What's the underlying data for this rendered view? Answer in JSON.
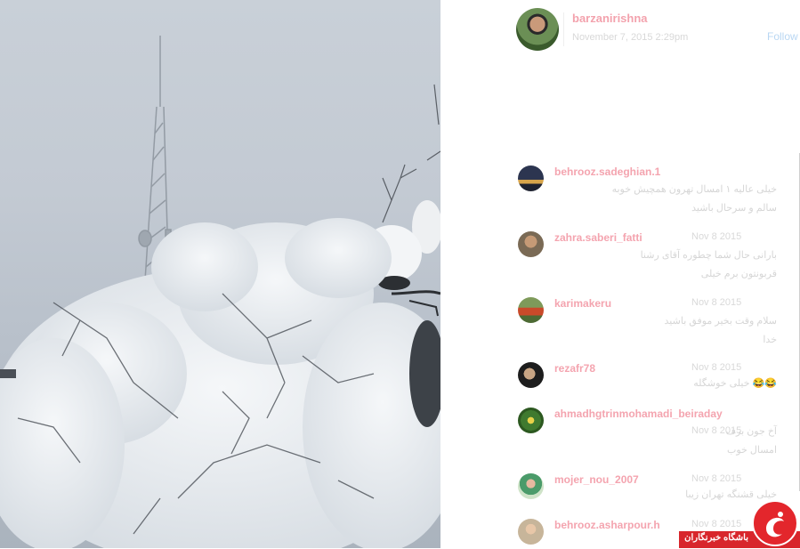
{
  "post": {
    "username": "barzanirishna",
    "date": "November 7, 2015 2:29pm",
    "follow_label": "Follow"
  },
  "comments": [
    {
      "username": "behrooz.sadeghian.1",
      "time": "",
      "lines": [
        "خیلی عالیه ۱ امسال تهرون همچیش خوبه",
        "سالم و سرحال باشید"
      ],
      "avatar_color": "#3b3a4a"
    },
    {
      "username": "zahra.saberi_fatti",
      "time": "Nov 8 2015",
      "lines": [
        "بارانی حال شما چطوره آقای رشنا",
        "قربونتون برم خیلی"
      ],
      "avatar_color": "#a28c6a"
    },
    {
      "username": "karimakeru",
      "time": "Nov 8 2015",
      "lines": [
        "سلام وقت بخیر موفق باشید",
        "خدا"
      ],
      "avatar_color": "#7a6b3a"
    },
    {
      "username": "rezafr78",
      "time": "Nov 8 2015",
      "lines": [
        "خیلی خوشگله 😂😂"
      ],
      "avatar_color": "#2a2a2a"
    },
    {
      "username": "ahmadhgtrinmohamadi_beiraday",
      "time": "Nov 8 2015",
      "lines": [
        "آخ جون برف",
        "امسال خوب"
      ],
      "avatar_color": "#4f8a3c"
    },
    {
      "username": "mojer_nou_2007",
      "time": "Nov 8 2015",
      "lines": [
        "خیلی قشنگه تهران زیبا"
      ],
      "avatar_color": "#8fb08a"
    },
    {
      "username": "behrooz.asharpour.h",
      "time": "Nov 8 2015",
      "lines": [
        ""
      ],
      "avatar_color": "#c9a98c"
    }
  ],
  "logo": {
    "text": "باشگاه خبرنگاران"
  }
}
